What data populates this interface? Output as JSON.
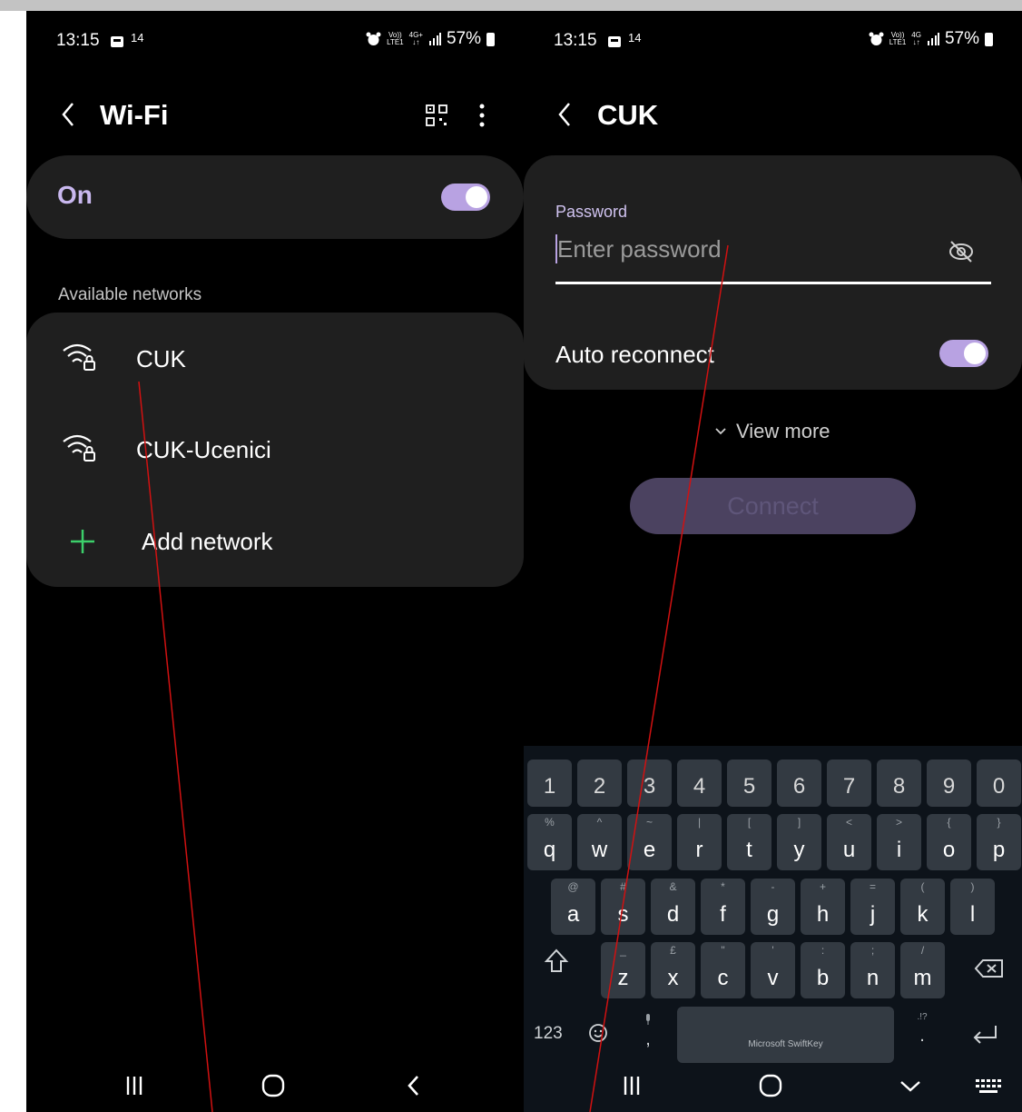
{
  "left_screen": {
    "status": {
      "time": "13:15",
      "notif_count": "14",
      "network_top": "Vo))",
      "network_bottom": "LTE1",
      "data_top": "4G+",
      "data_bottom": "↓↑",
      "battery": "57%"
    },
    "header": {
      "title": "Wi-Fi"
    },
    "toggle_card": {
      "label": "On",
      "state": true
    },
    "section_label": "Available networks",
    "networks": [
      {
        "name": "CUK"
      },
      {
        "name": "CUK-Ucenici"
      }
    ],
    "add_network": "Add network"
  },
  "right_screen": {
    "status": {
      "time": "13:15",
      "notif_count": "14",
      "network_top": "Vo))",
      "network_bottom": "LTE1",
      "data_top": "4G",
      "data_bottom": "↓↑",
      "battery": "57%"
    },
    "header": {
      "title": "CUK"
    },
    "password": {
      "label": "Password",
      "placeholder": "Enter password",
      "value": ""
    },
    "auto_reconnect": {
      "label": "Auto reconnect",
      "state": true
    },
    "view_more": "View more",
    "connect": "Connect",
    "keyboard": {
      "brand": "Microsoft SwiftKey",
      "numbers": [
        "1",
        "2",
        "3",
        "4",
        "5",
        "6",
        "7",
        "8",
        "9",
        "0"
      ],
      "row1": [
        [
          "q",
          "%"
        ],
        [
          "w",
          "^"
        ],
        [
          "e",
          "~"
        ],
        [
          "r",
          "|"
        ],
        [
          "t",
          "["
        ],
        [
          "y",
          "]"
        ],
        [
          "u",
          "<"
        ],
        [
          "i",
          ">"
        ],
        [
          "o",
          "{"
        ],
        [
          "p",
          "}"
        ]
      ],
      "row2": [
        [
          "a",
          "@"
        ],
        [
          "s",
          "#"
        ],
        [
          "d",
          "&"
        ],
        [
          "f",
          "*"
        ],
        [
          "g",
          "-"
        ],
        [
          "h",
          "+"
        ],
        [
          "j",
          "="
        ],
        [
          "k",
          "("
        ],
        [
          "l",
          ")"
        ]
      ],
      "row3": [
        [
          "z",
          "_"
        ],
        [
          "x",
          "£"
        ],
        [
          "c",
          "\""
        ],
        [
          "v",
          "'"
        ],
        [
          "b",
          ":"
        ],
        [
          "n",
          ";"
        ],
        [
          "m",
          "/"
        ]
      ],
      "num_switch": "123",
      "comma": ",",
      "period": ".",
      "punct_hint": ".!?"
    }
  },
  "colors": {
    "accent": "#b8a2e2",
    "card": "#1f1f1f",
    "plus": "#3ccf6a",
    "annotation": "#d11111"
  }
}
